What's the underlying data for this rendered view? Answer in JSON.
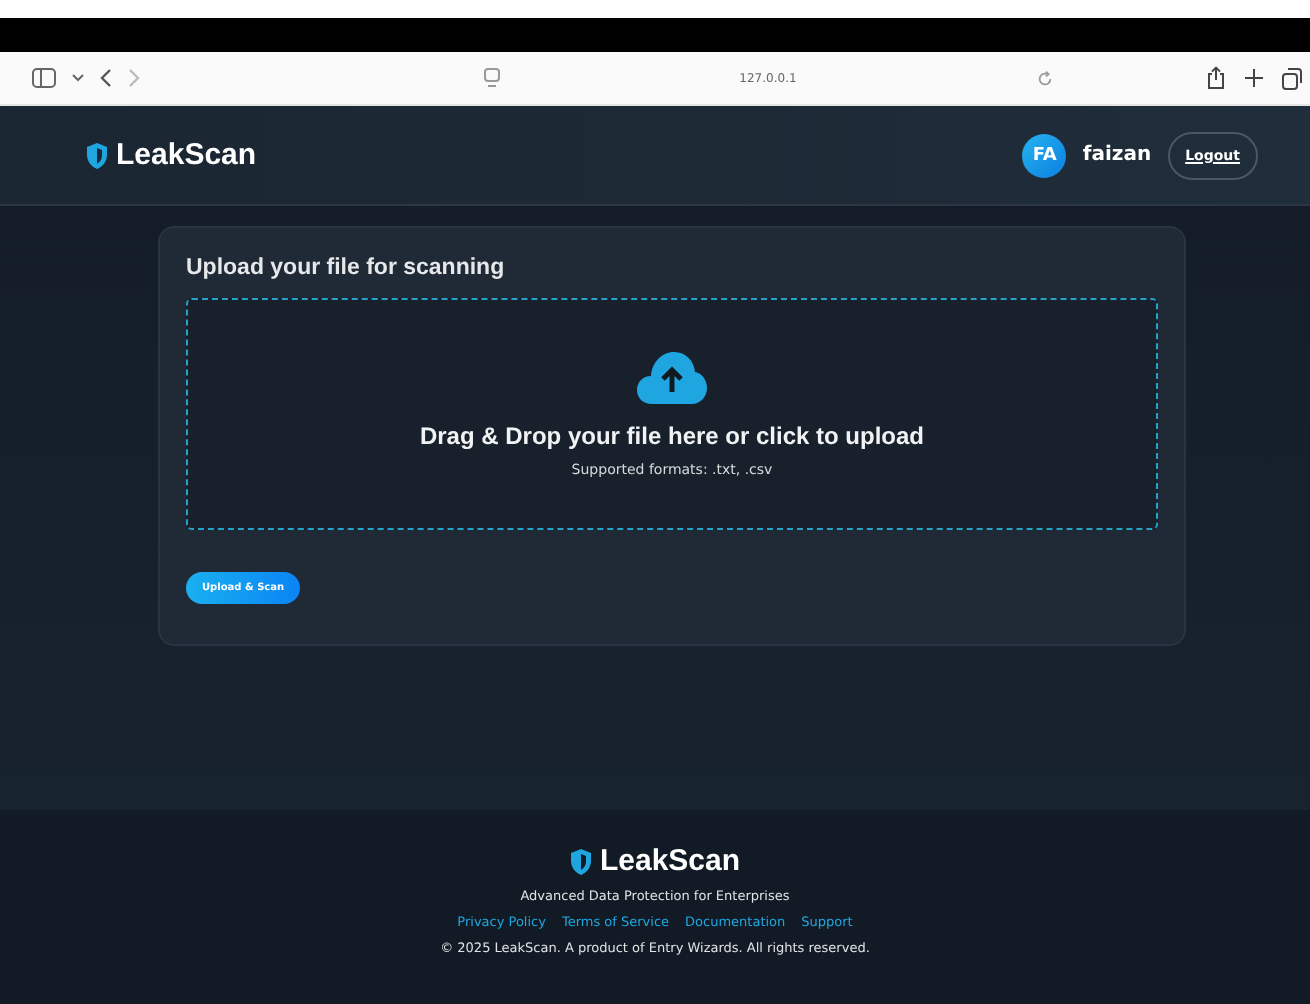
{
  "browser": {
    "address": "127.0.0.1"
  },
  "header": {
    "brand": "LeakScan",
    "avatar": "FA",
    "username": "faizan",
    "logout": "Logout"
  },
  "upload": {
    "title": "Upload your file for scanning",
    "drop_text": "Drag & Drop your file here or click to upload",
    "formats": "Supported formats: .txt, .csv",
    "button": "Upload & Scan"
  },
  "footer": {
    "brand": "LeakScan",
    "tagline": "Advanced Data Protection for Enterprises",
    "links": [
      "Privacy Policy",
      "Terms of Service",
      "Documentation",
      "Support"
    ],
    "copyright": "© 2025 LeakScan. A product of Entry Wizards. All rights reserved."
  }
}
